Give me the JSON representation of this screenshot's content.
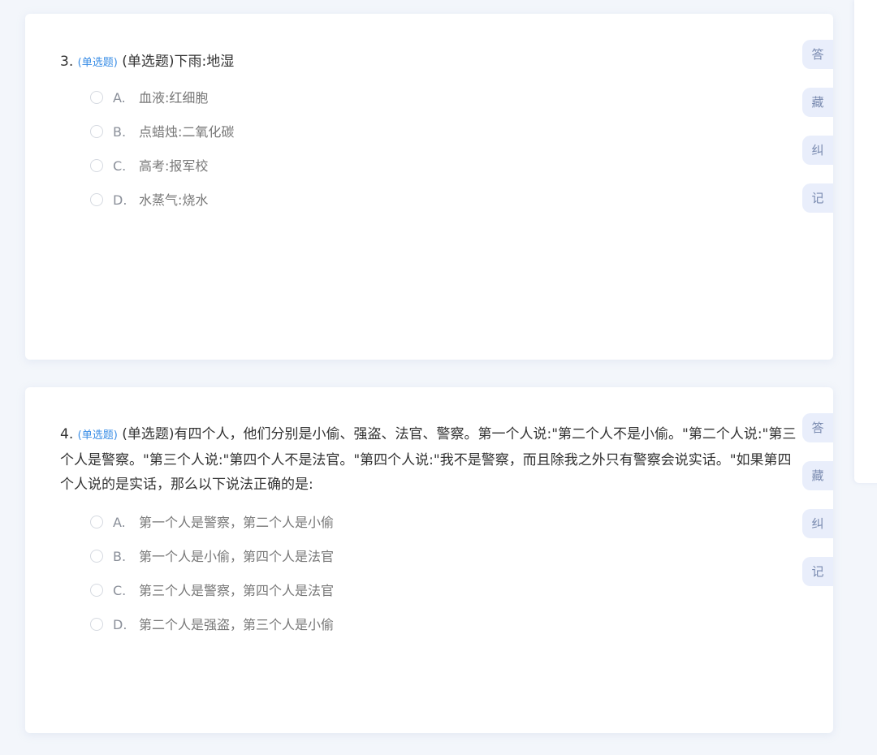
{
  "questions": [
    {
      "number": "3.",
      "type_tag": "(单选题)",
      "stem": "(单选题)下雨:地湿",
      "options": [
        {
          "letter": "A.",
          "text": "血液:红细胞"
        },
        {
          "letter": "B.",
          "text": "点蜡烛:二氧化碳"
        },
        {
          "letter": "C.",
          "text": "高考:报军校"
        },
        {
          "letter": "D.",
          "text": "水蒸气:烧水"
        }
      ]
    },
    {
      "number": "4.",
      "type_tag": "(单选题)",
      "stem": "(单选题)有四个人，他们分别是小偷、强盗、法官、警察。第一个人说:\"第二个人不是小偷。\"第二个人说:\"第三个人是警察。\"第三个人说:\"第四个人不是法官。\"第四个人说:\"我不是警察，而且除我之外只有警察会说实话。\"如果第四个人说的是实话，那么以下说法正确的是:",
      "options": [
        {
          "letter": "A.",
          "text": "第一个人是警察，第二个人是小偷"
        },
        {
          "letter": "B.",
          "text": "第一个人是小偷，第四个人是法官"
        },
        {
          "letter": "C.",
          "text": "第三个人是警察，第四个人是法官"
        },
        {
          "letter": "D.",
          "text": "第二个人是强盗，第三个人是小偷"
        }
      ]
    }
  ],
  "side_tools": {
    "answer": "答",
    "collect": "藏",
    "correct": "纠",
    "note": "记"
  }
}
